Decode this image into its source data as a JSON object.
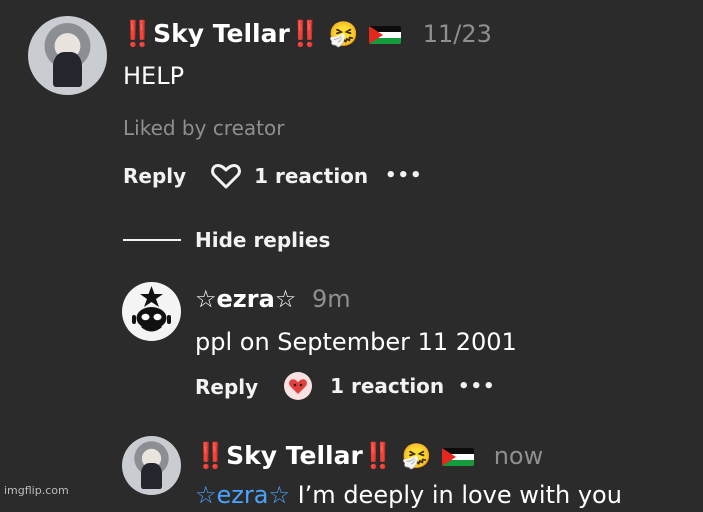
{
  "comments": [
    {
      "name": "Sky Tellar",
      "badge_left": "‼️",
      "badge_right": "‼️",
      "emoji": "🤧",
      "time": "11/23",
      "text": "HELP",
      "liked_note": "Liked by creator",
      "reply_label": "Reply",
      "reactions": "1 reaction",
      "more": "•••"
    }
  ],
  "thread": {
    "hide_replies_label": "Hide replies"
  },
  "replies": [
    {
      "name": "☆ezra☆",
      "time": "9m",
      "text": "ppl on September 11 2001",
      "reply_label": "Reply",
      "reactions": "1 reaction",
      "more": "•••"
    },
    {
      "name": "Sky Tellar",
      "badge_left": "‼️",
      "badge_right": "‼️",
      "emoji": "🤧",
      "time": "now",
      "mention": "☆ezra☆",
      "text": " I’m deeply in love with you"
    }
  ],
  "watermark": "imgflip.com",
  "colors": {
    "background": "#2b2b2b",
    "alert_red": "#e4271f",
    "mention_blue": "#4aa3ff",
    "muted": "#8f8f8f"
  }
}
